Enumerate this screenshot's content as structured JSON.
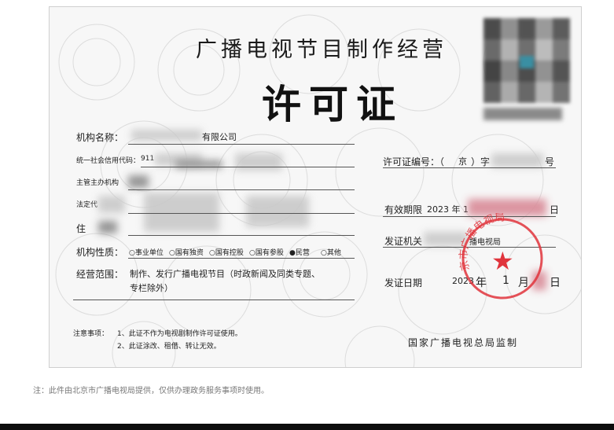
{
  "certificate": {
    "title_line1": "广播电视节目制作经营",
    "title_line2": "许可证",
    "org_name_label": "机构名称：",
    "org_name_value": "有限公司",
    "credit_code_label": "统一社会信用代码：",
    "credit_code_value": "911",
    "authority_label": "主管主办机构",
    "legal_rep_label": "法定代",
    "address_label": "住",
    "nature_label": "机构性质：",
    "nature_options": [
      "○事业单位",
      "○国有独资",
      "○国有控股",
      "○国有参股",
      "●民营",
      "○其他"
    ],
    "scope_label": "经营范围：",
    "scope_value_line1": "制作、发行广播电视节目（时政新闻及同类专题、",
    "scope_value_line2": "专栏除外）",
    "license_no_label": "许可证编号：（",
    "license_no_mid": "京",
    "license_no_mid2": "）字",
    "license_no_end": "号",
    "validity_label": "有效期限",
    "validity_value": "2023 年 1",
    "validity_end": "日",
    "issuer_label": "发证机关",
    "issuer_value": "播电视局",
    "issue_date_label": "发证日期",
    "issue_date_year": "2023",
    "issue_date_year_unit": "年",
    "issue_date_month": "1",
    "issue_date_month_unit": "月",
    "issue_date_day_unit": "日",
    "notes_label": "注意事项：",
    "note_1": "1、此证不作为电视剧制作许可证使用。",
    "note_2": "2、此证涂改、租借、转让无效。",
    "supervisor": "国家广播电视总局监制",
    "seal_text": "京市广播电视局",
    "seal_star": "★"
  },
  "footer_note": "注：此件由北京市广播电视局提供，仅供办理政务服务事项时使用。",
  "colors": {
    "seal_red": "#e0343c",
    "background": "#f7f7f7",
    "text": "#222222"
  }
}
